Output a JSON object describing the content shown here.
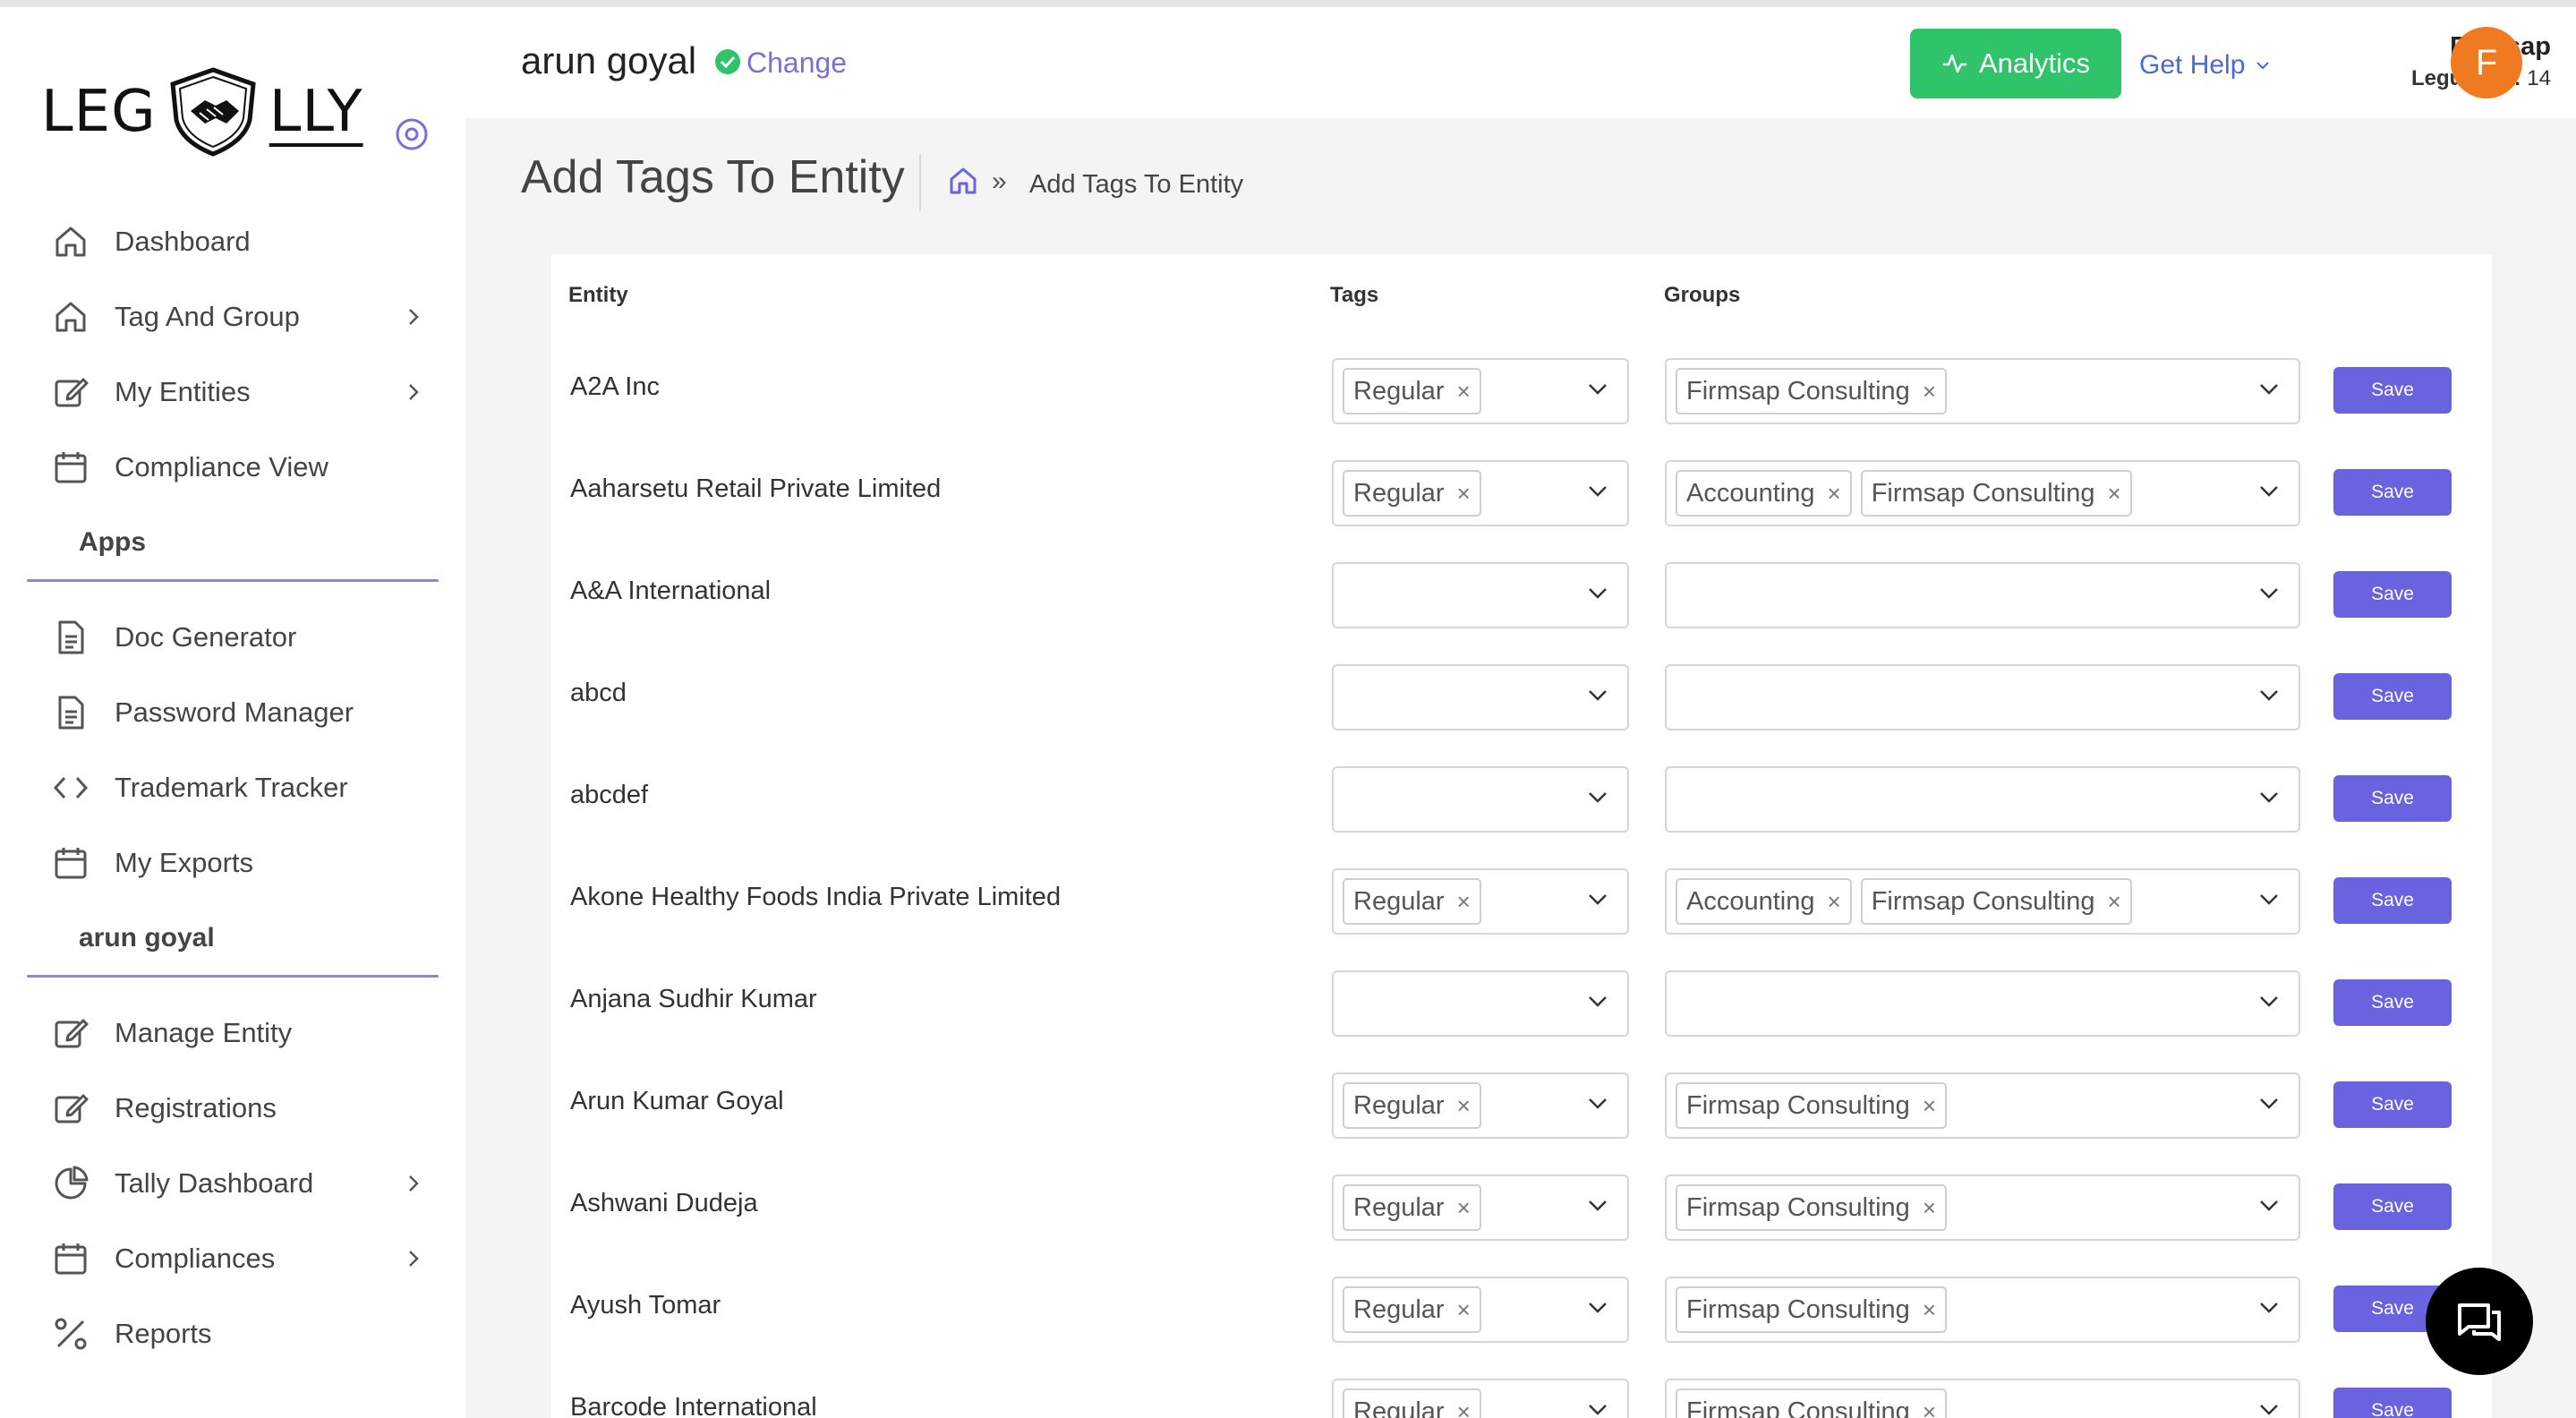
{
  "logo": {
    "head": "LEG",
    "tail": "LLY"
  },
  "sidebar": {
    "items_main": [
      {
        "label": "Dashboard",
        "icon": "home-icon",
        "chevron": false
      },
      {
        "label": "Tag And Group",
        "icon": "home-icon",
        "chevron": true
      },
      {
        "label": "My Entities",
        "icon": "edit-icon",
        "chevron": true
      },
      {
        "label": "Compliance View",
        "icon": "calendar-icon",
        "chevron": false
      }
    ],
    "section_apps": "Apps",
    "items_apps": [
      {
        "label": "Doc Generator",
        "icon": "document-icon",
        "chevron": false
      },
      {
        "label": "Password Manager",
        "icon": "document-icon",
        "chevron": false
      },
      {
        "label": "Trademark Tracker",
        "icon": "code-icon",
        "chevron": false
      },
      {
        "label": "My Exports",
        "icon": "calendar-icon",
        "chevron": false
      }
    ],
    "section_user": "arun goyal",
    "items_user": [
      {
        "label": "Manage Entity",
        "icon": "edit-icon",
        "chevron": false
      },
      {
        "label": "Registrations",
        "icon": "edit-icon",
        "chevron": false
      },
      {
        "label": "Tally Dashboard",
        "icon": "pie-chart-icon",
        "chevron": true
      },
      {
        "label": "Compliances",
        "icon": "calendar-icon",
        "chevron": true
      },
      {
        "label": "Reports",
        "icon": "percent-icon",
        "chevron": false
      }
    ]
  },
  "header": {
    "user_name": "arun goyal",
    "change_label": "Change",
    "analytics_label": "Analytics",
    "get_help_label": "Get Help",
    "firm_name": "Firmsap",
    "legully_id_label": "Legully ID:",
    "legully_id_value": "14",
    "avatar_initial": "F"
  },
  "page": {
    "title": "Add Tags To Entity",
    "breadcrumb_current": "Add Tags To Entity",
    "breadcrumb_separator": "»"
  },
  "table": {
    "headers": {
      "entity": "Entity",
      "tags": "Tags",
      "groups": "Groups"
    },
    "save_label": "Save",
    "rows": [
      {
        "entity": "A2A Inc",
        "tags": [
          "Regular"
        ],
        "groups": [
          "Firmsap Consulting"
        ]
      },
      {
        "entity": "Aaharsetu Retail Private Limited",
        "tags": [
          "Regular"
        ],
        "groups": [
          "Accounting",
          "Firmsap Consulting"
        ]
      },
      {
        "entity": "A&A International",
        "tags": [],
        "groups": []
      },
      {
        "entity": "abcd",
        "tags": [],
        "groups": []
      },
      {
        "entity": "abcdef",
        "tags": [],
        "groups": []
      },
      {
        "entity": "Akone Healthy Foods India Private Limited",
        "tags": [
          "Regular"
        ],
        "groups": [
          "Accounting",
          "Firmsap Consulting"
        ]
      },
      {
        "entity": "Anjana Sudhir Kumar",
        "tags": [],
        "groups": []
      },
      {
        "entity": "Arun Kumar Goyal",
        "tags": [
          "Regular"
        ],
        "groups": [
          "Firmsap Consulting"
        ]
      },
      {
        "entity": "Ashwani Dudeja",
        "tags": [
          "Regular"
        ],
        "groups": [
          "Firmsap Consulting"
        ]
      },
      {
        "entity": "Ayush Tomar",
        "tags": [
          "Regular"
        ],
        "groups": [
          "Firmsap Consulting"
        ]
      },
      {
        "entity": "Barcode International",
        "tags": [
          "Regular"
        ],
        "groups": [
          "Firmsap Consulting"
        ]
      }
    ]
  },
  "colors": {
    "accent": "#6a63e0",
    "analytics_green": "#2fc46a",
    "avatar_orange": "#f07a21",
    "link_purple": "#7b6fd9"
  }
}
